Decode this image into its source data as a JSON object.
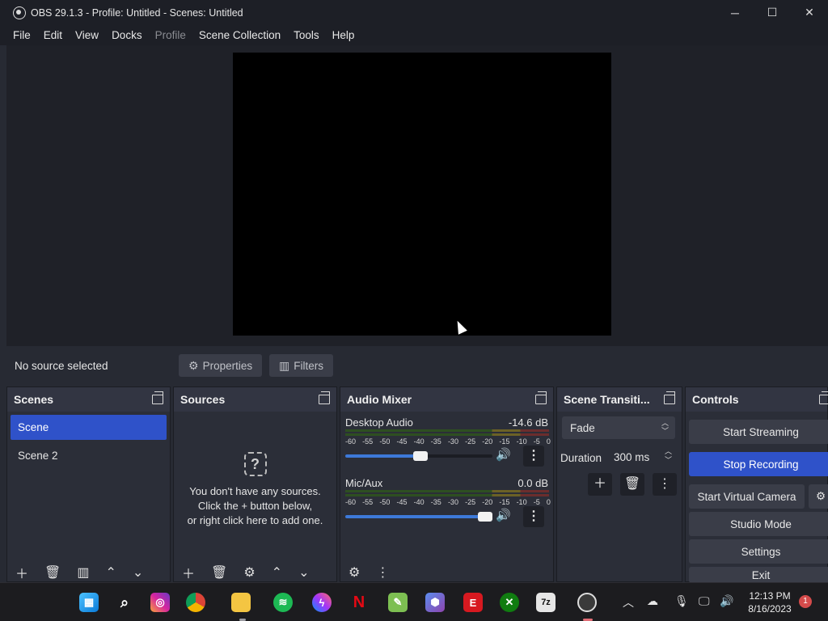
{
  "window": {
    "title": "OBS 29.1.3 - Profile: Untitled - Scenes: Untitled"
  },
  "menu": [
    "File",
    "Edit",
    "View",
    "Docks",
    "Profile",
    "Scene Collection",
    "Tools",
    "Help"
  ],
  "context": {
    "no_source": "No source selected",
    "properties": "Properties",
    "filters": "Filters"
  },
  "scenes": {
    "title": "Scenes",
    "items": [
      "Scene",
      "Scene 2"
    ]
  },
  "sources": {
    "title": "Sources",
    "empty_lines": [
      "You don't have any sources.",
      "Click the + button below,",
      "or right click here to add one."
    ],
    "empty_icon": "?"
  },
  "mixer": {
    "title": "Audio Mixer",
    "ticks": [
      "-60",
      "-55",
      "-50",
      "-45",
      "-40",
      "-35",
      "-30",
      "-25",
      "-20",
      "-15",
      "-10",
      "-5",
      "0"
    ],
    "channels": [
      {
        "name": "Desktop Audio",
        "db": "-14.6 dB",
        "volume": 0.56
      },
      {
        "name": "Mic/Aux",
        "db": "0.0 dB",
        "volume": 1.0
      }
    ]
  },
  "transitions": {
    "title": "Scene Transiti...",
    "selected": "Fade",
    "duration_label": "Duration",
    "duration_value": "300 ms"
  },
  "controls": {
    "title": "Controls",
    "start_streaming": "Start Streaming",
    "stop_recording": "Stop Recording",
    "start_virtual_camera": "Start Virtual Camera",
    "studio_mode": "Studio Mode",
    "settings": "Settings",
    "exit": "Exit"
  },
  "taskbar": {
    "time": "12:13 PM",
    "date": "8/16/2023",
    "notifications": "1",
    "apps": [
      "start-icon",
      "search-icon",
      "instagram-icon",
      "chrome-icon",
      "file-explorer-icon",
      "spotify-icon",
      "messenger-icon",
      "netflix-icon",
      "notepad-icon",
      "copilot-icon",
      "espn-icon",
      "xbox-icon",
      "7zip-icon",
      "obs-icon"
    ],
    "app_labels": {
      "espn": "E",
      "netflix": "N",
      "seven_zip": "7z"
    }
  },
  "colors": {
    "accent": "#2f52c9",
    "panel": "#2b2e38",
    "background": "#272a33"
  }
}
